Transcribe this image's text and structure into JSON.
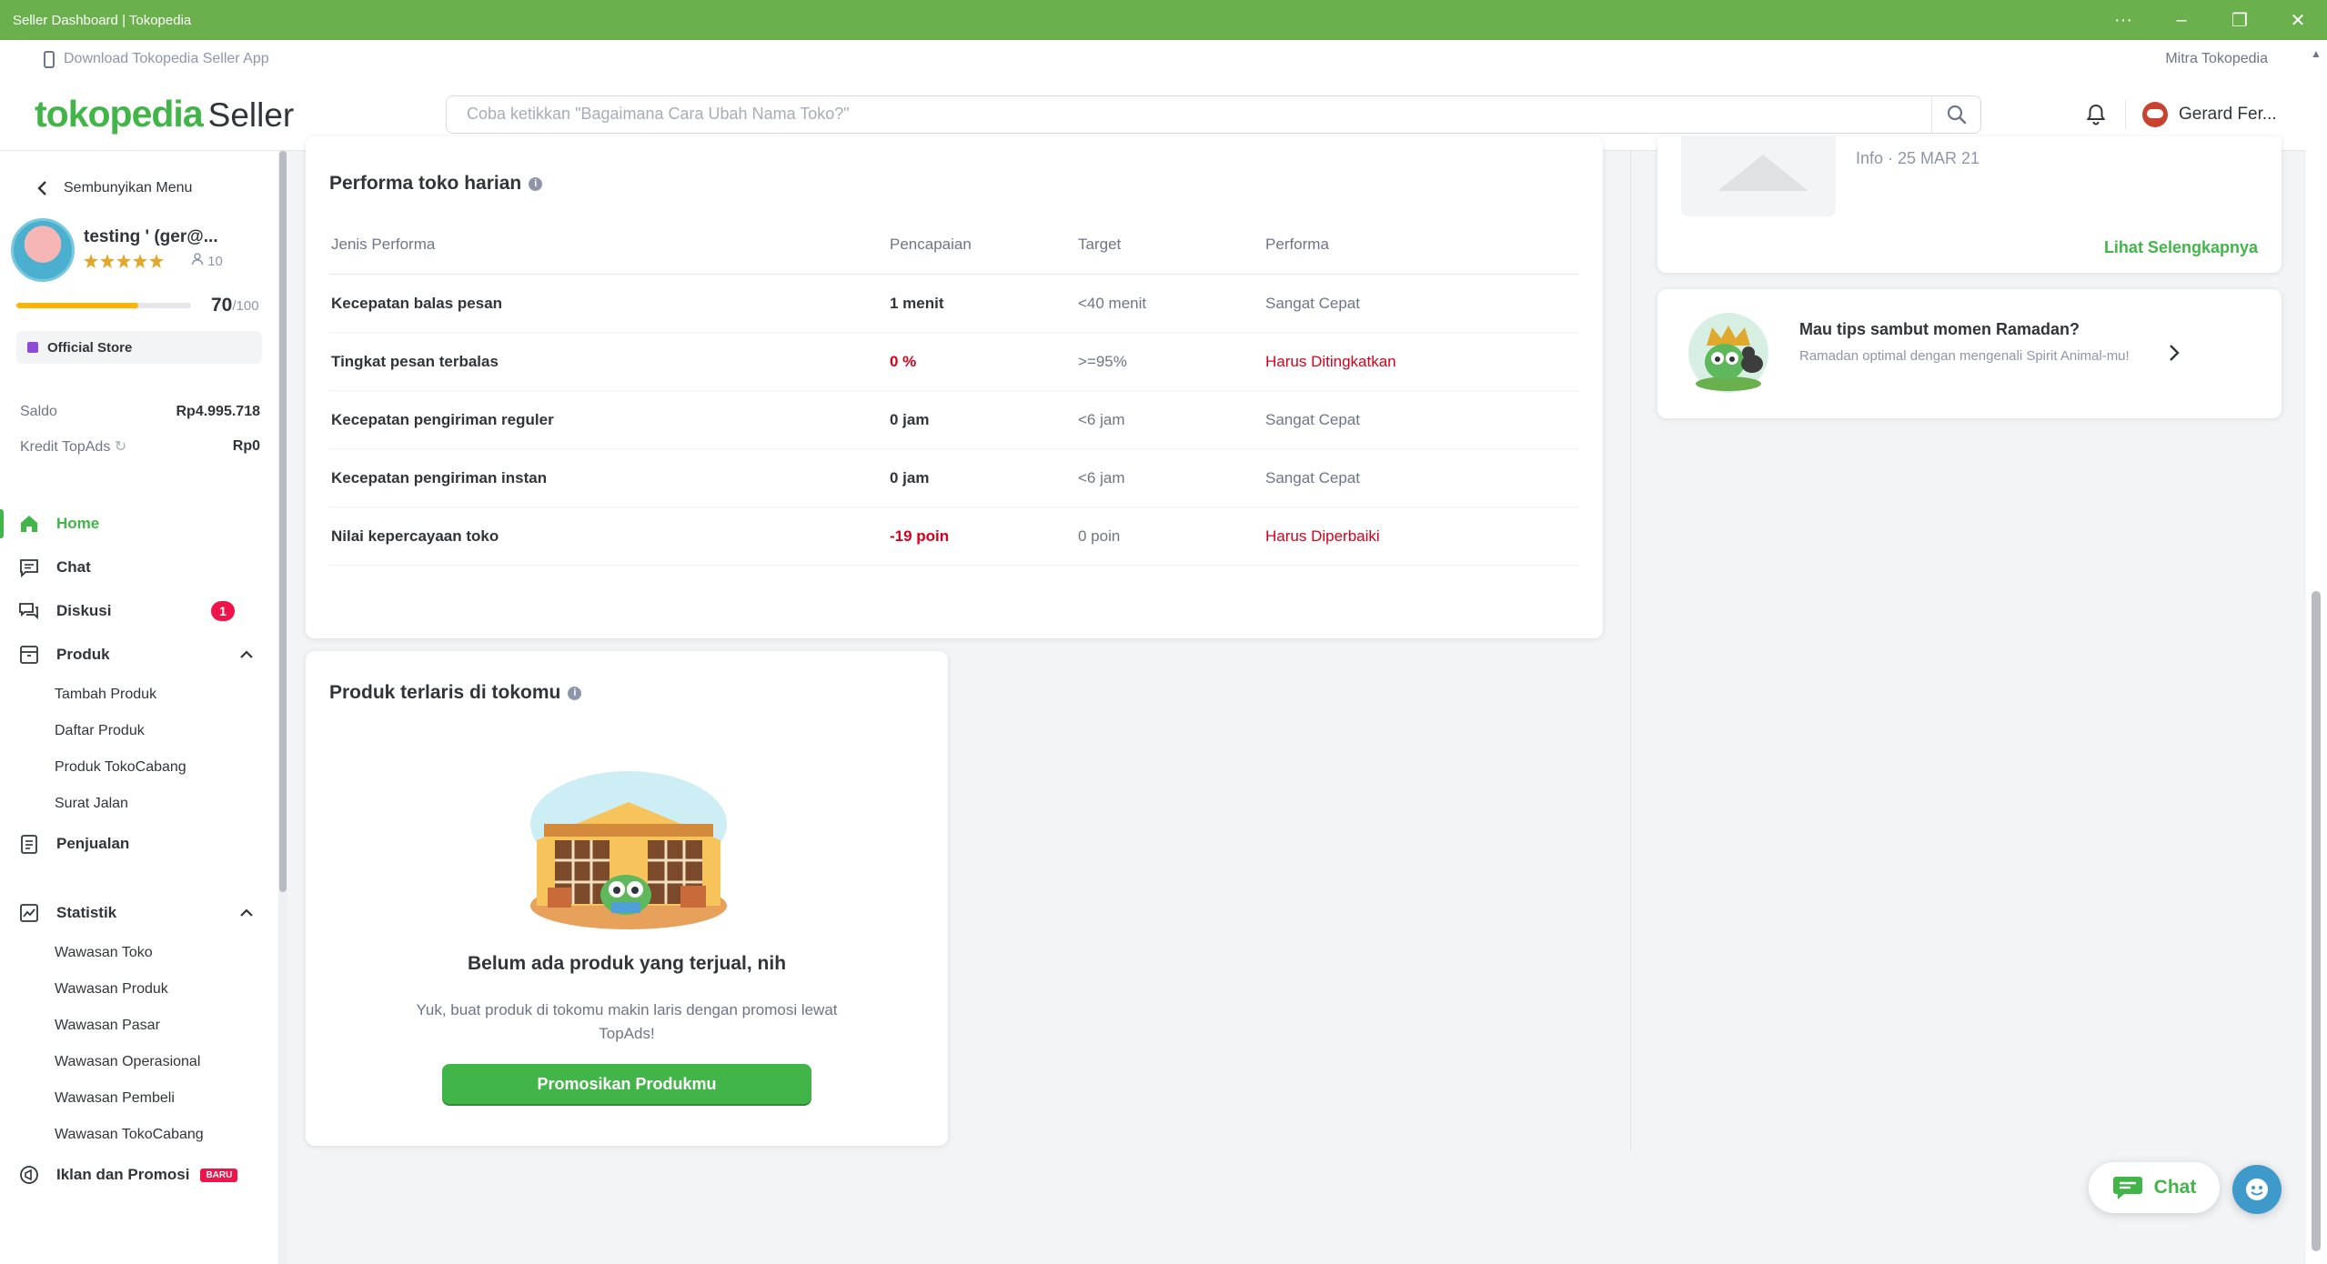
{
  "window": {
    "title": "Seller Dashboard | Tokopedia",
    "more": "···",
    "minimize": "–",
    "restore": "❐",
    "close": "✕"
  },
  "topbar": {
    "download": "Download Tokopedia Seller App",
    "mitra": "Mitra Tokopedia"
  },
  "header": {
    "logo_main": "tokopedia",
    "logo_sub": "Seller",
    "search_placeholder": "Coba ketikkan \"Bagaimana Cara Ubah Nama Toko?\"",
    "user_name": "Gerard Fer..."
  },
  "sidebar": {
    "hide_menu": "Sembunyikan Menu",
    "shop_name": "testing ' (ger@...",
    "followers": "10",
    "score": "70",
    "score_max": "/100",
    "score_fraction": 0.7,
    "badge": "Official Store",
    "saldo_label": "Saldo",
    "saldo_value": "Rp4.995.718",
    "topads_label": "Kredit TopAds",
    "topads_value": "Rp0",
    "nav": {
      "home": "Home",
      "chat": "Chat",
      "diskusi": "Diskusi",
      "diskusi_badge": "1",
      "produk": "Produk",
      "produk_sub": [
        "Tambah Produk",
        "Daftar Produk",
        "Produk TokoCabang",
        "Surat Jalan"
      ],
      "penjualan": "Penjualan",
      "statistik": "Statistik",
      "statistik_sub": [
        "Wawasan Toko",
        "Wawasan Produk",
        "Wawasan Pasar",
        "Wawasan Operasional",
        "Wawasan Pembeli",
        "Wawasan TokoCabang"
      ],
      "iklan": "Iklan dan Promosi",
      "iklan_badge": "BARU"
    }
  },
  "performance": {
    "title": "Performa toko harian",
    "headers": [
      "Jenis Performa",
      "Pencapaian",
      "Target",
      "Performa"
    ],
    "rows": [
      {
        "name": "Kecepatan balas pesan",
        "value": "1 menit",
        "target": "<40 menit",
        "status": "Sangat Cepat",
        "alert": false
      },
      {
        "name": "Tingkat pesan terbalas",
        "value": "0 %",
        "target": ">=95%",
        "status": "Harus Ditingkatkan",
        "alert": true
      },
      {
        "name": "Kecepatan pengiriman reguler",
        "value": "0 jam",
        "target": "<6 jam",
        "status": "Sangat Cepat",
        "alert": false
      },
      {
        "name": "Kecepatan pengiriman instan",
        "value": "0 jam",
        "target": "<6 jam",
        "status": "Sangat Cepat",
        "alert": false
      },
      {
        "name": "Nilai kepercayaan toko",
        "value": "-19 poin",
        "target": "0 poin",
        "status": "Harus Diperbaiki",
        "alert": true
      }
    ]
  },
  "bestseller": {
    "title": "Produk terlaris di tokomu",
    "empty_title": "Belum ada produk yang terjual, nih",
    "empty_desc": "Yuk, buat produk di tokomu makin laris dengan promosi lewat TopAds!",
    "button": "Promosikan Produkmu"
  },
  "news": {
    "meta": "Info · 25 MAR 21",
    "more": "Lihat Selengkapnya"
  },
  "tips": {
    "title": "Mau tips sambut momen Ramadan?",
    "desc": "Ramadan optimal dengan mengenali Spirit Animal-mu!"
  },
  "floating": {
    "chat": "Chat"
  },
  "colors": {
    "brand_green": "#42b549",
    "titlebar_green": "#6ab04c",
    "alert_red": "#d6001c",
    "badge_red": "#ef144a"
  }
}
